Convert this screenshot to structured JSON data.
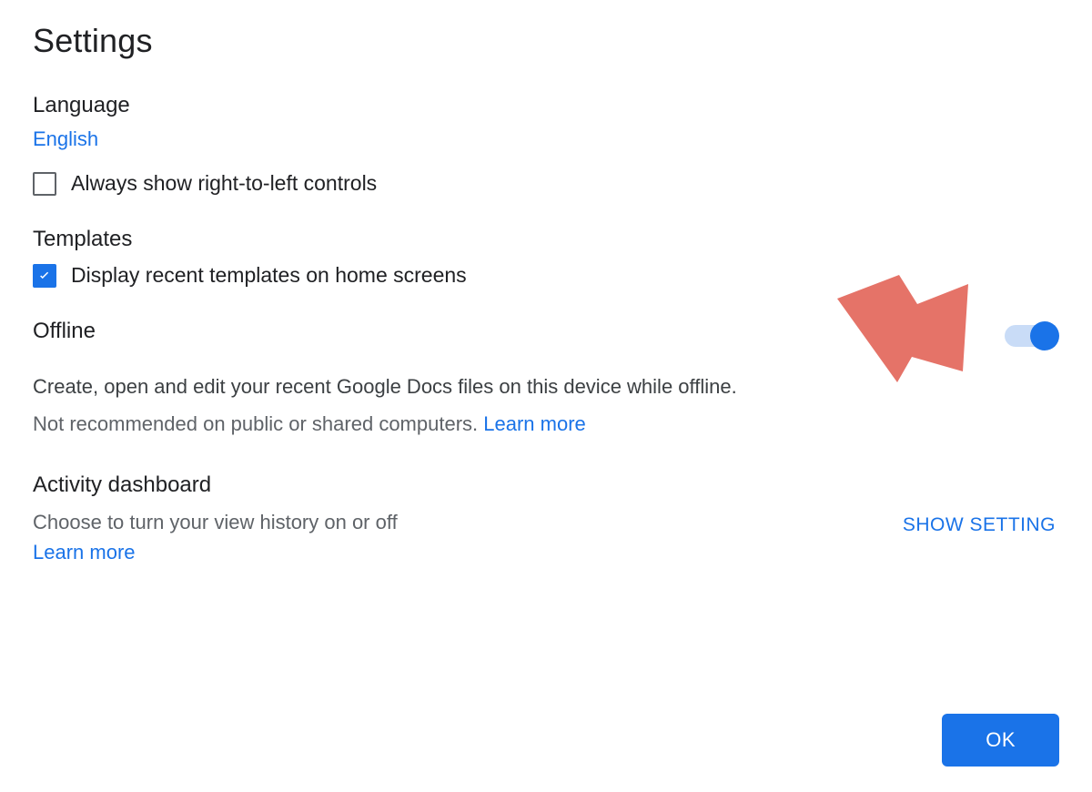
{
  "title": "Settings",
  "language": {
    "heading": "Language",
    "selected": "English",
    "rtl_checkbox_label": "Always show right-to-left controls",
    "rtl_checked": false
  },
  "templates": {
    "heading": "Templates",
    "display_recent_label": "Display recent templates on home screens",
    "display_recent_checked": true
  },
  "offline": {
    "heading": "Offline",
    "description": "Create, open and edit your recent Google Docs files on this device while offline.",
    "caution": "Not recommended on public or shared computers. ",
    "learn_more": "Learn more",
    "toggle_on": true
  },
  "activity": {
    "heading": "Activity dashboard",
    "description": "Choose to turn your view history on or off",
    "learn_more": "Learn more",
    "show_setting_label": "SHOW SETTING"
  },
  "footer": {
    "ok_label": "OK"
  },
  "colors": {
    "accent": "#1a73e8",
    "arrow": "#e57368"
  }
}
